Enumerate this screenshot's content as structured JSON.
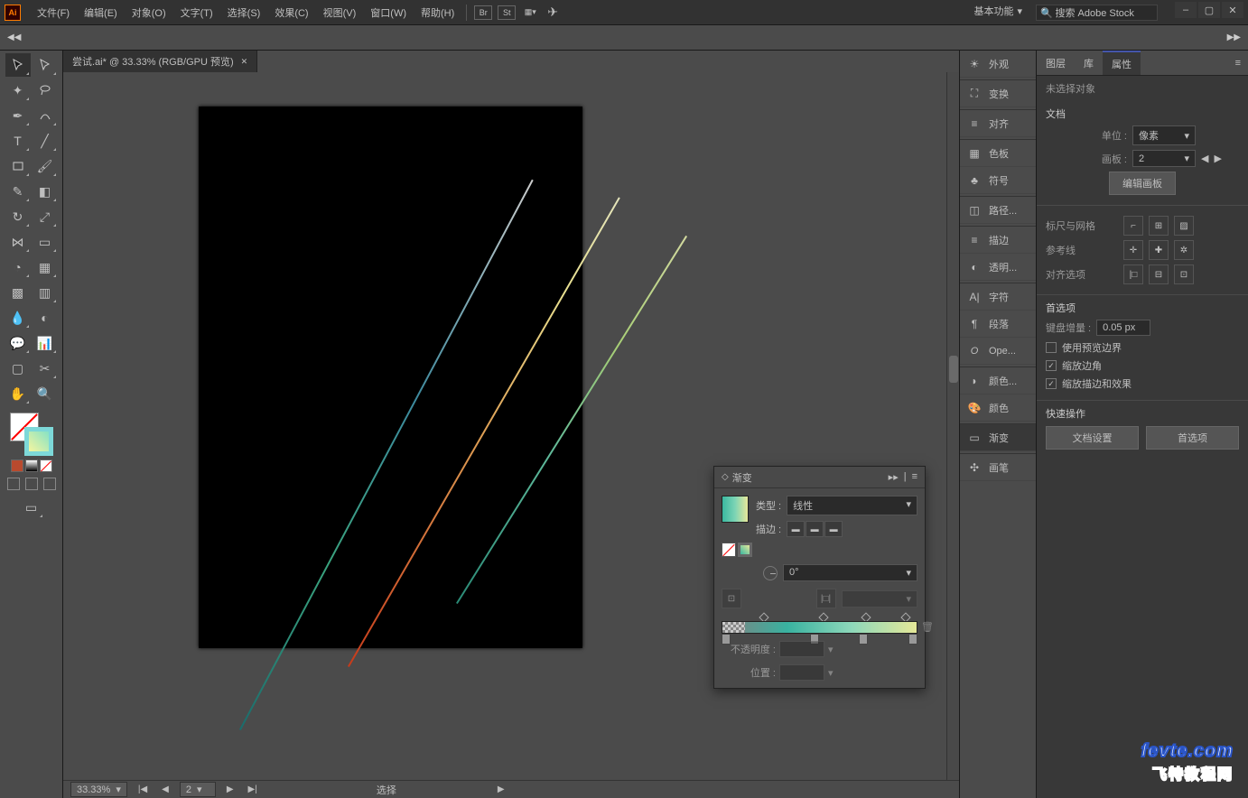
{
  "menu": {
    "items": [
      "文件(F)",
      "编辑(E)",
      "对象(O)",
      "文字(T)",
      "选择(S)",
      "效果(C)",
      "视图(V)",
      "窗口(W)",
      "帮助(H)"
    ]
  },
  "workspace": "基本功能",
  "search_ph": "搜索 Adobe Stock",
  "doc_tab": "尝试.ai* @ 33.33% (RGB/GPU 预览)",
  "dock": {
    "items": [
      "外观",
      "变换",
      "对齐",
      "色板",
      "符号",
      "路径...",
      "描边",
      "透明...",
      "字符",
      "段落",
      "Ope...",
      "颜色...",
      "颜色",
      "渐变",
      "画笔"
    ]
  },
  "props": {
    "tabs": [
      "图层",
      "库",
      "属性"
    ],
    "no_sel": "未选择对象",
    "doc": "文档",
    "unit_lb": "单位 :",
    "unit_v": "像素",
    "artboard_lb": "画板 :",
    "artboard_v": "2",
    "edit_ab": "编辑画板",
    "rg": "标尺与网格",
    "guides": "参考线",
    "align_opt": "对齐选项",
    "prefs": "首选项",
    "kbinc_lb": "键盘增量 :",
    "kbinc_v": "0.05 px",
    "chk1": "使用预览边界",
    "chk2": "缩放边角",
    "chk3": "缩放描边和效果",
    "quick": "快速操作",
    "docset": "文档设置",
    "prefbtn": "首选项"
  },
  "grad": {
    "title": "渐变",
    "type_lb": "类型 :",
    "type_v": "线性",
    "stroke_lb": "描边 :",
    "angle_v": "0°",
    "opac_lb": "不透明度 :",
    "pos_lb": "位置 :"
  },
  "status": {
    "zoom": "33.33%",
    "page": "2",
    "sel": "选择"
  },
  "watermark": {
    "l1": "fevte.com",
    "l2": "飞特教程网"
  }
}
